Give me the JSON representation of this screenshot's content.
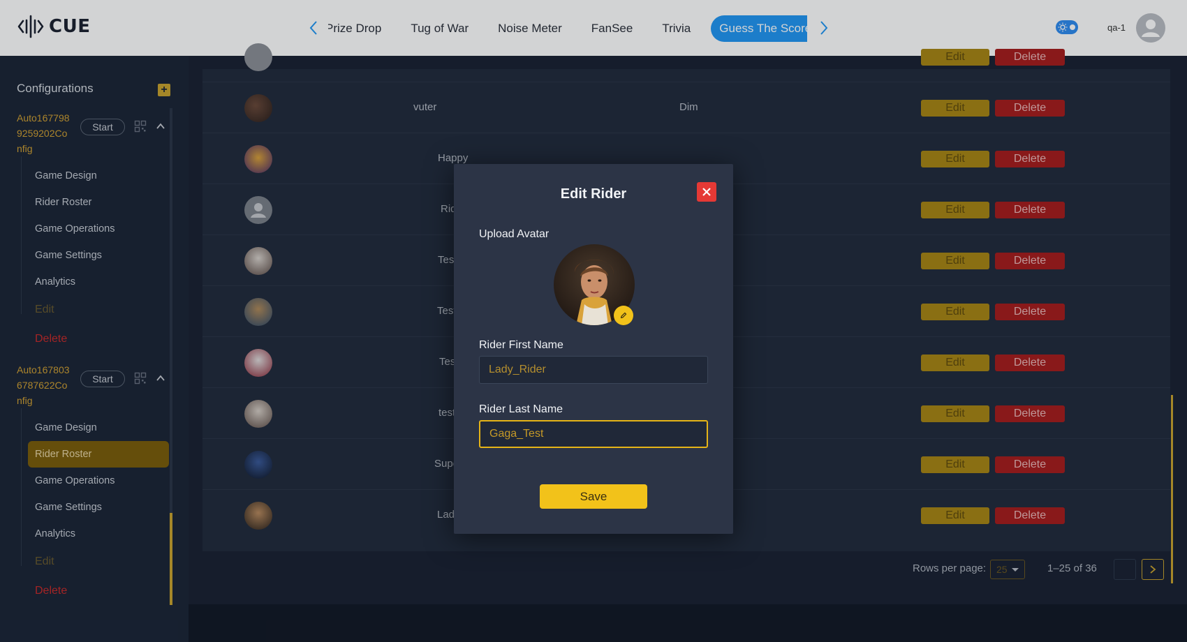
{
  "header": {
    "logo_text": "CUE",
    "nav_tabs": [
      "Prize Drop",
      "Tug of War",
      "Noise Meter",
      "FanSee",
      "Trivia",
      "Guess The Score"
    ],
    "active_tab": "Guess The Score",
    "user_name": "qa-1",
    "icons": [
      "chevron-left-icon",
      "chevron-right-icon",
      "sun-icon",
      "user-avatar-icon"
    ]
  },
  "sidebar": {
    "title": "Configurations",
    "add_label": "+",
    "configs": [
      {
        "name": "Auto167798 9259202Co nfig",
        "start_label": "Start",
        "items": [
          "Game Design",
          "Rider Roster",
          "Game Operations",
          "Game Settings",
          "Analytics"
        ],
        "edit_label": "Edit",
        "delete_label": "Delete"
      },
      {
        "name": "Auto167803 6787622Co nfig",
        "start_label": "Start",
        "items": [
          "Game Design",
          "Rider Roster",
          "Game Operations",
          "Game Settings",
          "Analytics"
        ],
        "active_item": "Rider Roster",
        "edit_label": "Edit",
        "delete_label": "Delete"
      }
    ]
  },
  "table": {
    "rows": [
      {
        "first": "vuter",
        "last": "Dim"
      },
      {
        "first": "Happy",
        "last": ""
      },
      {
        "first": "Rider",
        "last": ""
      },
      {
        "first": "Test_U",
        "last": ""
      },
      {
        "first": "Test_N",
        "last": ""
      },
      {
        "first": "Test_I",
        "last": ""
      },
      {
        "first": "test_D",
        "last": ""
      },
      {
        "first": "Super_I",
        "last": ""
      },
      {
        "first": "Lady_V",
        "last": ""
      }
    ],
    "edit_label": "Edit",
    "delete_label": "Delete",
    "footer": {
      "rows_per_page_label": "Rows per page:",
      "rows_per_page_value": "25",
      "page_info": "1–25 of 36"
    }
  },
  "modal": {
    "title": "Edit Rider",
    "upload_label": "Upload Avatar",
    "first_name_label": "Rider First Name",
    "first_name_value": "Lady_Rider",
    "last_name_label": "Rider Last Name",
    "last_name_value": "Gaga_Test",
    "save_label": "Save"
  },
  "colors": {
    "accent_blue": "#2196f3",
    "gold": "#f2c21a",
    "danger": "#e53935",
    "panel": "#2c3446"
  }
}
